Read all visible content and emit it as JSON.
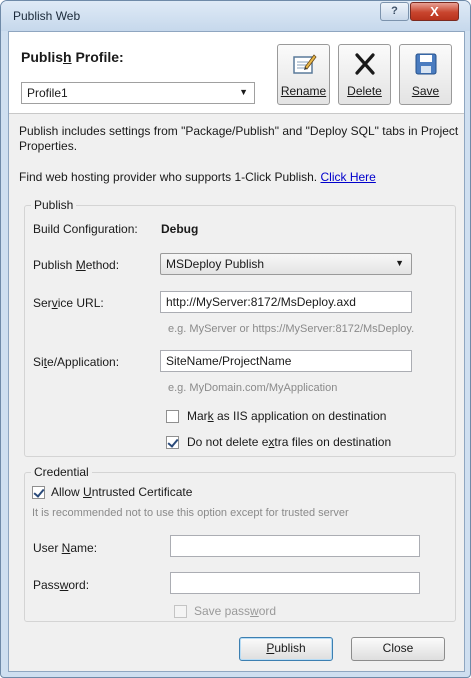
{
  "window": {
    "title": "Publish Web"
  },
  "titlebar_buttons": {
    "help": "?",
    "close": "X"
  },
  "profile": {
    "label_pre": "Publis",
    "label_key": "h",
    "label_post": " Profile:",
    "selected": "Profile1",
    "rename_key": "R",
    "rename_rest": "ename",
    "delete_key": "D",
    "delete_rest": "elete",
    "save_key": "S",
    "save_rest": "ave"
  },
  "info": {
    "line1": "Publish includes settings from \"Package/Publish\" and \"Deploy SQL\" tabs in Project Properties.",
    "line2": "Find web hosting provider who supports 1-Click Publish.",
    "link": "Click Here"
  },
  "publish_group": {
    "title": "Publish",
    "build_config_label": "Build Configuration:",
    "build_config_value": "Debug",
    "method_label_pre": "Publish ",
    "method_label_key": "M",
    "method_label_post": "ethod:",
    "method_value": "MSDeploy Publish",
    "service_label_pre": "Ser",
    "service_label_key": "v",
    "service_label_post": "ice URL:",
    "service_value": "http://MyServer:8172/MsDeploy.axd",
    "service_hint": "e.g. MyServer or https://MyServer:8172/MsDeploy.",
    "site_label_pre": "Si",
    "site_label_key": "t",
    "site_label_post": "e/Application:",
    "site_value": "SiteName/ProjectName",
    "site_hint": "e.g. MyDomain.com/MyApplication",
    "mark_iis_pre": "Mar",
    "mark_iis_key": "k",
    "mark_iis_post": " as IIS application on destination",
    "mark_iis_checked": false,
    "no_delete_pre": "Do not delete e",
    "no_delete_key": "x",
    "no_delete_post": "tra files on destination",
    "no_delete_checked": true
  },
  "credential_group": {
    "title": "Credential",
    "allow_pre": "Allow ",
    "allow_key": "U",
    "allow_post": "ntrusted Certificate",
    "allow_checked": true,
    "warning": "It is recommended not to use this option except for trusted server",
    "user_pre": "User ",
    "user_key": "N",
    "user_post": "ame:",
    "user_value": "",
    "pass_pre": "Pass",
    "pass_key": "w",
    "pass_post": "ord:",
    "pass_value": "",
    "save_pre": "Save pass",
    "save_key": "w",
    "save_post": "ord",
    "save_checked": false
  },
  "footer": {
    "publish_key": "P",
    "publish_rest": "ublish",
    "close": "Close"
  },
  "colors": {
    "link": "#0000cc",
    "hint": "#8a8a8a",
    "titlebar": "#c6d8ec"
  }
}
